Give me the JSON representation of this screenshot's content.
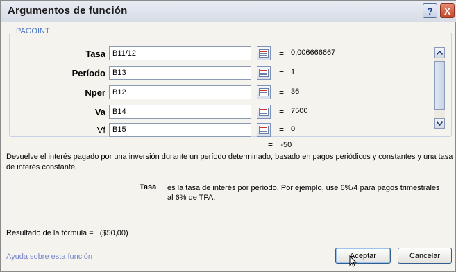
{
  "window": {
    "title": "Argumentos de función",
    "help_glyph": "?",
    "close_glyph": "X"
  },
  "function_name": "PAGOINT",
  "arguments": [
    {
      "label": "Tasa",
      "value": "B11/12",
      "result": "0,006666667",
      "bold": true
    },
    {
      "label": "Período",
      "value": "B13",
      "result": "1",
      "bold": true
    },
    {
      "label": "Nper",
      "value": "B12",
      "result": "36",
      "bold": true
    },
    {
      "label": "Va",
      "value": "B14",
      "result": "7500",
      "bold": true
    },
    {
      "label": "Vf",
      "value": "B15",
      "result": "0",
      "bold": false
    }
  ],
  "equals_sign": "=",
  "function_result": "-50",
  "description": "Devuelve el interés pagado por una inversión durante un período determinado, basado en pagos periódicos y constantes y una tasa de interés constante.",
  "parameter_help": {
    "name": "Tasa",
    "text": "es la tasa de interés por período. Por ejemplo, use 6%/4 para pagos trimestrales al 6% de TPA."
  },
  "formula_result": {
    "label": "Resultado de la fórmula =",
    "value": "($50,00)"
  },
  "help_link": "Ayuda sobre esta función",
  "buttons": {
    "ok": "Aceptar",
    "cancel": "Cancelar"
  },
  "colors": {
    "link": "#7a86c9",
    "group_label": "#4a76c7",
    "ok_border": "#2f5d8f"
  },
  "icons": [
    "help-icon",
    "close-icon",
    "collapse-dialog-icon",
    "scroll-up-icon",
    "scroll-down-icon",
    "mouse-cursor-icon"
  ]
}
